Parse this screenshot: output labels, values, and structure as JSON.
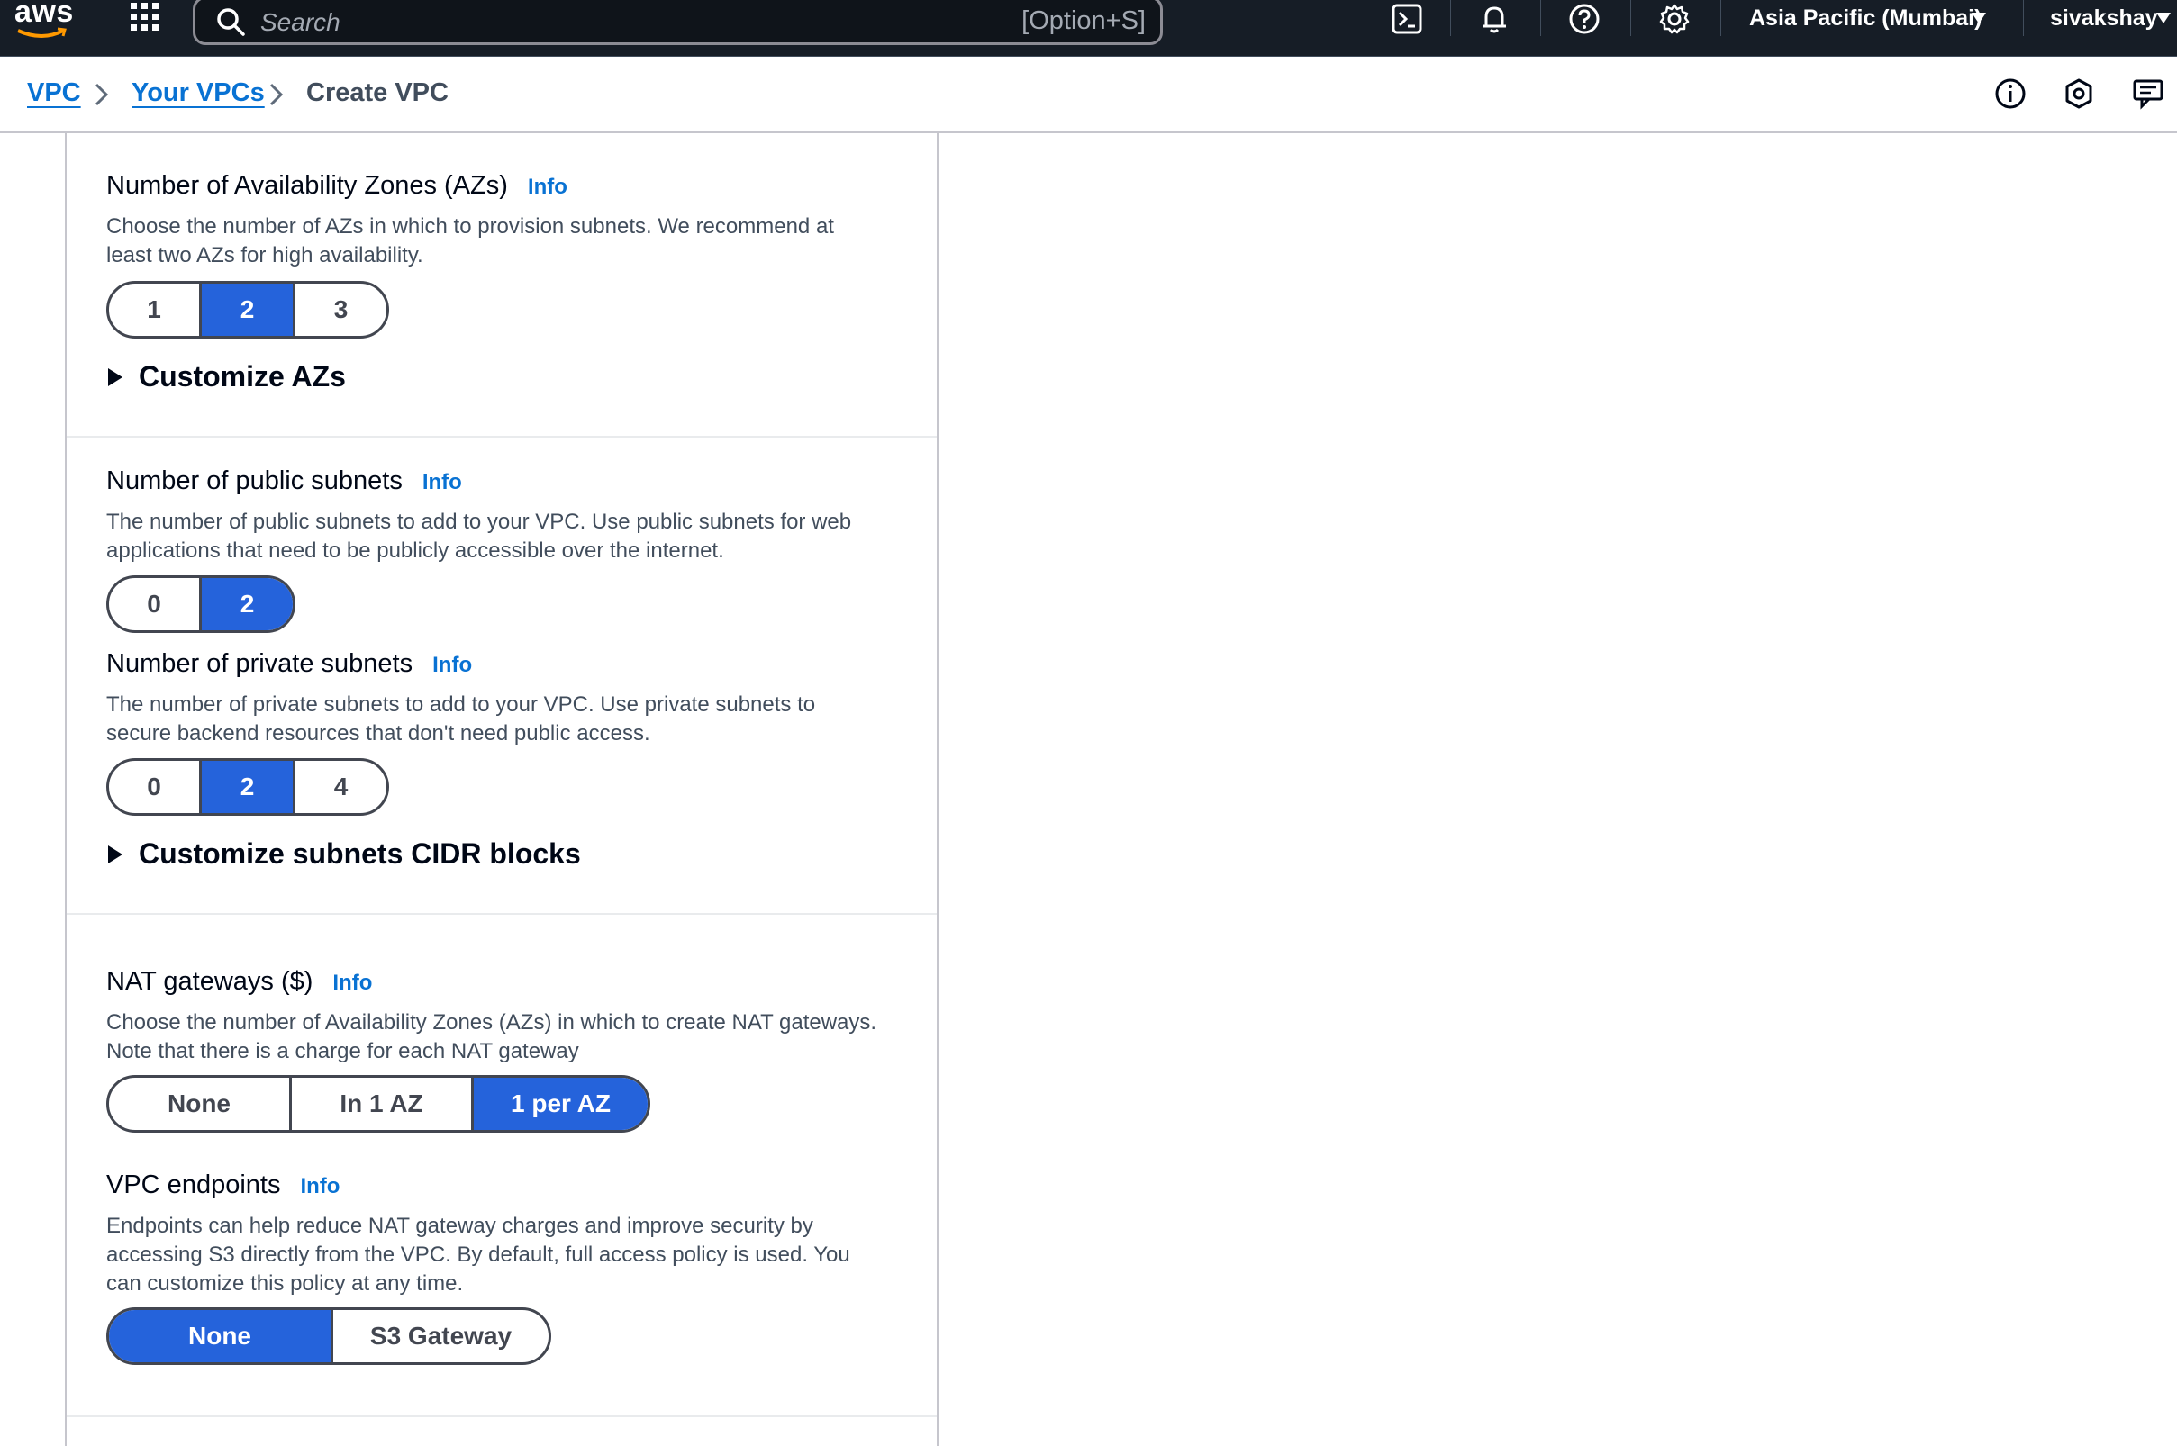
{
  "topbar": {
    "logo_text": "aws",
    "search_placeholder": "Search",
    "search_shortcut": "[Option+S]",
    "region": "Asia Pacific (Mumbai)",
    "user": "sivakshay",
    "icons": [
      "services-grid-icon",
      "search-icon",
      "cloudshell-icon",
      "bell-icon",
      "help-icon",
      "settings-icon"
    ]
  },
  "breadcrumb": {
    "items": [
      "VPC",
      "Your VPCs"
    ],
    "current": "Create VPC"
  },
  "form": {
    "az": {
      "label": "Number of Availability Zones (AZs)",
      "info": "Info",
      "description_line1": "Choose the number of AZs in which to provision subnets. We recommend at",
      "description_line2": "least two AZs for high availability.",
      "options": [
        "1",
        "2",
        "3"
      ],
      "selected": "2",
      "customize": "Customize AZs"
    },
    "public_subnets": {
      "label": "Number of public subnets",
      "info": "Info",
      "description_line1": "The number of public subnets to add to your VPC. Use public subnets for web",
      "description_line2": "applications that need to be publicly accessible over the internet.",
      "options": [
        "0",
        "2"
      ],
      "selected": "2"
    },
    "private_subnets": {
      "label": "Number of private subnets",
      "info": "Info",
      "description_line1": "The number of private subnets to add to your VPC. Use private subnets to",
      "description_line2": "secure backend resources that don't need public access.",
      "options": [
        "0",
        "2",
        "4"
      ],
      "selected": "2",
      "customize": "Customize subnets CIDR blocks"
    },
    "nat": {
      "label": "NAT gateways ($)",
      "info": "Info",
      "description_line1": "Choose the number of Availability Zones (AZs) in which to create NAT gateways.",
      "description_line2": "Note that there is a charge for each NAT gateway",
      "options": [
        "None",
        "In 1 AZ",
        "1 per AZ"
      ],
      "selected": "1 per AZ"
    },
    "endpoints": {
      "label": "VPC endpoints",
      "info": "Info",
      "description_line1": "Endpoints can help reduce NAT gateway charges and improve security by",
      "description_line2": "accessing S3 directly from the VPC. By default, full access policy is used. You",
      "description_line3": "can customize this policy at any time.",
      "options": [
        "None",
        "S3 Gateway"
      ],
      "selected": "None"
    }
  },
  "colors": {
    "topbar_bg": "#161d26",
    "link_blue": "#0972d3",
    "selected_blue": "#2563db",
    "border_dark": "#424650"
  }
}
